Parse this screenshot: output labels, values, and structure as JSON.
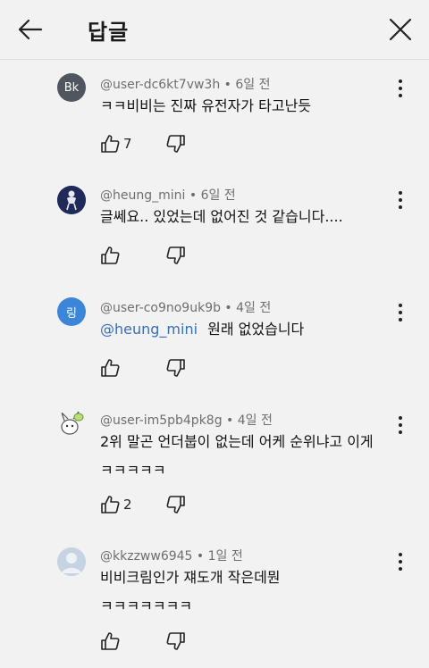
{
  "header": {
    "title": "답글"
  },
  "comments": [
    {
      "avatar_text": "Bk",
      "avatar_color": "#4f5660",
      "meta": "@user-dc6kt7vw3h • 6일 전",
      "line1": "ㅋㅋ비비는 진짜 유전자가 타고난듯",
      "line2": "",
      "mention": "",
      "likes": "7"
    },
    {
      "avatar_text": "",
      "avatar_color": "#1f2a5a",
      "meta": "@heung_mini • 6일 전",
      "line1": "글쎄요.. 있었는데 없어진 것 같습니다....",
      "line2": "",
      "mention": "",
      "likes": ""
    },
    {
      "avatar_text": "링",
      "avatar_color": "#3b86d8",
      "meta": "@user-co9no9uk9b • 4일 전",
      "line1": "원래 없었습니다",
      "line2": "",
      "mention": "@heung_mini",
      "likes": ""
    },
    {
      "avatar_text": "",
      "avatar_color": "#f2f2f2",
      "meta": "@user-im5pb4pk8g • 4일 전",
      "line1": "2위 말곤 언더붑이 없는데 어케 순위냐고 이게",
      "line2": "ㅋㅋㅋㅋㅋ",
      "mention": "",
      "likes": "2"
    },
    {
      "avatar_text": "",
      "avatar_color": "#c6d3e3",
      "meta": "@kkzzww6945 • 1일 전",
      "line1": "비비크림인가 쟤도개 작은데뭔",
      "line2": "ㅋㅋㅋㅋㅋㅋㅋ",
      "mention": "",
      "likes": ""
    }
  ]
}
